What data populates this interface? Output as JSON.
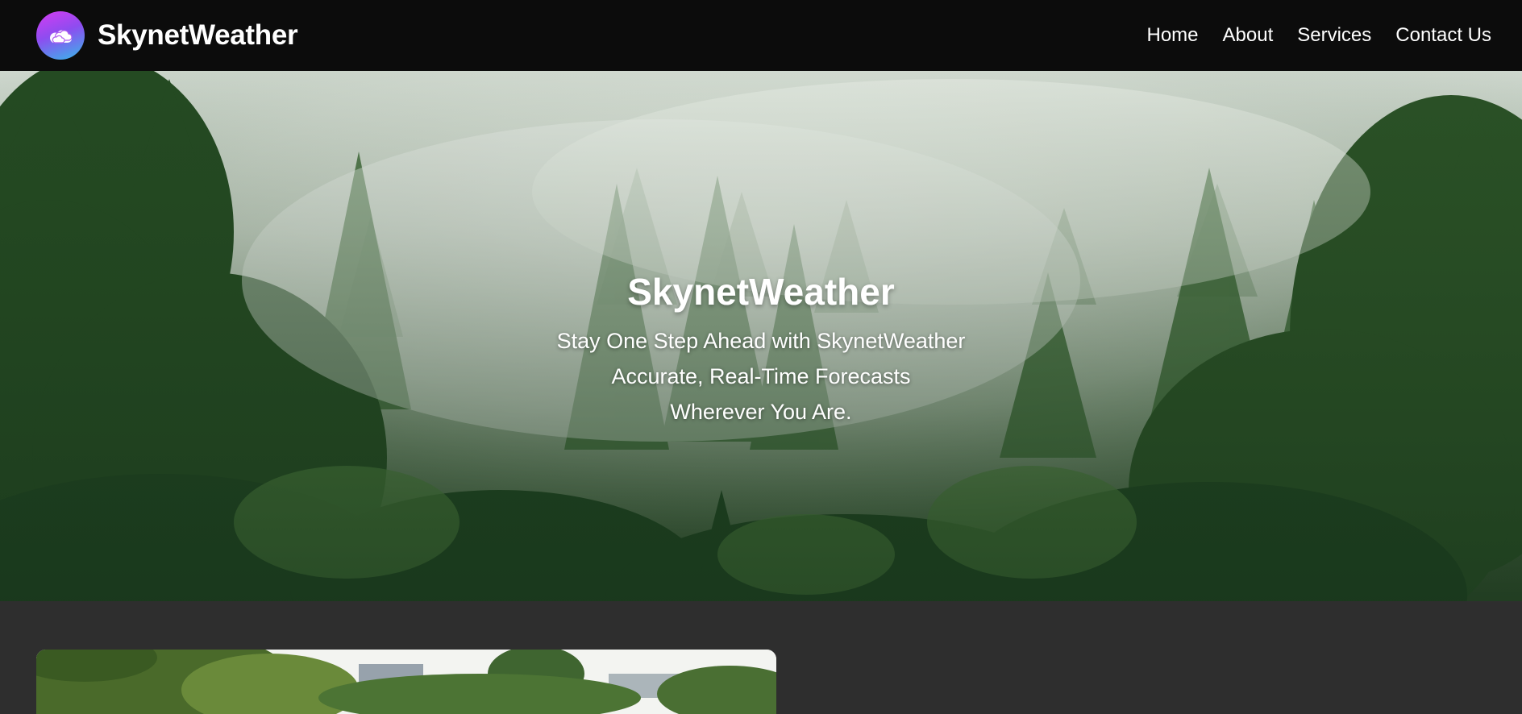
{
  "brand": {
    "name": "SkynetWeather",
    "logo_icon": "cloud-cluster-icon"
  },
  "nav": {
    "items": [
      {
        "label": "Home"
      },
      {
        "label": "About"
      },
      {
        "label": "Services"
      },
      {
        "label": "Contact Us"
      }
    ]
  },
  "hero": {
    "title": "SkynetWeather",
    "lines": [
      "Stay One Step Ahead with SkynetWeather",
      "Accurate, Real-Time Forecasts",
      "Wherever You Are."
    ],
    "background": "misty-pine-forest-photo"
  },
  "lower_section": {
    "card_image": "park-trees-photo"
  },
  "colors": {
    "navbar_bg": "#0c0c0c",
    "page_bg": "#2e2e2e",
    "text": "#ffffff",
    "logo_gradient_start": "#d63cf2",
    "logo_gradient_end": "#36b9ea"
  }
}
